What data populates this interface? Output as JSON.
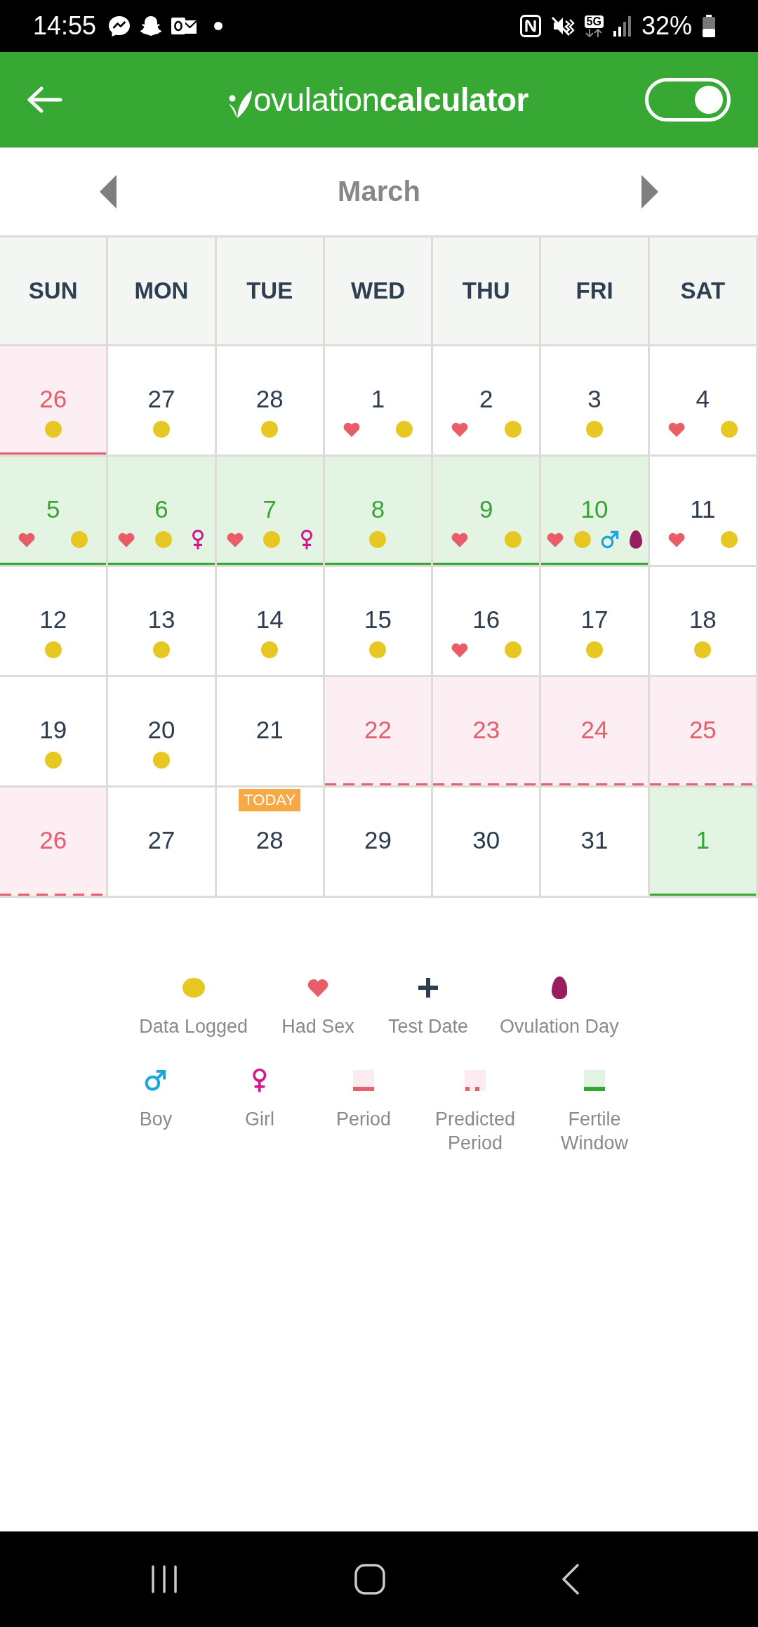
{
  "status_bar": {
    "time": "14:55",
    "network": "5G",
    "battery": "32%"
  },
  "header": {
    "logo": "ovulation**calculator**",
    "toggle": {
      "on": true
    }
  },
  "month_nav": {
    "month": "March"
  },
  "calendar": {
    "weekdays": [
      "SUN",
      "MON",
      "TUE",
      "WED",
      "THU",
      "FRI",
      "SAT"
    ],
    "weeks": [
      {
        "days": [
          {
            "day": "26",
            "kind": "period",
            "markers": [
              {
                "kind": "data_logged"
              }
            ]
          },
          {
            "day": "27",
            "kind": "normal",
            "markers": [
              {
                "kind": "data_logged"
              }
            ]
          },
          {
            "day": "28",
            "kind": "normal",
            "markers": [
              {
                "kind": "data_logged"
              }
            ]
          },
          {
            "day": "1",
            "kind": "normal",
            "markers": [
              {
                "kind": "had_sex"
              },
              {
                "kind": "data_logged"
              }
            ]
          },
          {
            "day": "2",
            "kind": "normal",
            "markers": [
              {
                "kind": "had_sex"
              },
              {
                "kind": "data_logged"
              }
            ]
          },
          {
            "day": "3",
            "kind": "normal",
            "markers": [
              {
                "kind": "data_logged"
              }
            ]
          },
          {
            "day": "4",
            "kind": "normal",
            "markers": [
              {
                "kind": "had_sex"
              },
              {
                "kind": "data_logged"
              }
            ]
          }
        ]
      },
      {
        "days": [
          {
            "day": "5",
            "kind": "fertile",
            "markers": [
              {
                "kind": "had_sex"
              },
              {
                "kind": "data_logged"
              }
            ]
          },
          {
            "day": "6",
            "kind": "fertile",
            "markers": [
              {
                "kind": "had_sex"
              },
              {
                "kind": "data_logged"
              },
              {
                "kind": "girl"
              }
            ]
          },
          {
            "day": "7",
            "kind": "fertile",
            "markers": [
              {
                "kind": "had_sex"
              },
              {
                "kind": "data_logged"
              },
              {
                "kind": "girl"
              }
            ]
          },
          {
            "day": "8",
            "kind": "fertile",
            "markers": [
              {
                "kind": "data_logged"
              }
            ]
          },
          {
            "day": "9",
            "kind": "fertile",
            "markers": [
              {
                "kind": "had_sex"
              },
              {
                "kind": "data_logged"
              }
            ]
          },
          {
            "day": "10",
            "kind": "fertile",
            "markers": [
              {
                "kind": "had_sex"
              },
              {
                "kind": "data_logged"
              },
              {
                "kind": "boy"
              },
              {
                "kind": "ovulation_day"
              }
            ]
          },
          {
            "day": "11",
            "kind": "normal",
            "markers": [
              {
                "kind": "had_sex"
              },
              {
                "kind": "data_logged"
              }
            ]
          }
        ]
      },
      {
        "days": [
          {
            "day": "12",
            "kind": "normal",
            "markers": [
              {
                "kind": "data_logged"
              }
            ]
          },
          {
            "day": "13",
            "kind": "normal",
            "markers": [
              {
                "kind": "data_logged"
              }
            ]
          },
          {
            "day": "14",
            "kind": "normal",
            "markers": [
              {
                "kind": "data_logged"
              }
            ]
          },
          {
            "day": "15",
            "kind": "normal",
            "markers": [
              {
                "kind": "data_logged"
              }
            ]
          },
          {
            "day": "16",
            "kind": "normal",
            "markers": [
              {
                "kind": "had_sex"
              },
              {
                "kind": "data_logged"
              }
            ]
          },
          {
            "day": "17",
            "kind": "normal",
            "markers": [
              {
                "kind": "data_logged"
              }
            ]
          },
          {
            "day": "18",
            "kind": "normal",
            "markers": [
              {
                "kind": "data_logged"
              }
            ]
          }
        ]
      },
      {
        "days": [
          {
            "day": "19",
            "kind": "normal",
            "markers": [
              {
                "kind": "data_logged"
              }
            ]
          },
          {
            "day": "20",
            "kind": "normal",
            "markers": [
              {
                "kind": "data_logged"
              }
            ]
          },
          {
            "day": "21",
            "kind": "normal"
          },
          {
            "day": "22",
            "kind": "predicted_period"
          },
          {
            "day": "23",
            "kind": "predicted_period"
          },
          {
            "day": "24",
            "kind": "predicted_period"
          },
          {
            "day": "25",
            "kind": "predicted_period"
          }
        ]
      },
      {
        "days": [
          {
            "day": "26",
            "kind": "predicted_period"
          },
          {
            "day": "27",
            "kind": "normal"
          },
          {
            "day": "28",
            "kind": "normal",
            "badge": "TODAY"
          },
          {
            "day": "29",
            "kind": "normal"
          },
          {
            "day": "30",
            "kind": "normal"
          },
          {
            "day": "31",
            "kind": "normal"
          },
          {
            "day": "1",
            "kind": "fertile"
          }
        ]
      }
    ]
  },
  "legend": {
    "rows": [
      {
        "items": [
          {
            "kind": "data_logged",
            "label": "Data Logged"
          },
          {
            "kind": "had_sex",
            "label": "Had Sex"
          },
          {
            "kind": "test_date",
            "label": "Test Date"
          },
          {
            "kind": "ovulation_day",
            "label": "Ovulation Day"
          }
        ]
      },
      {
        "items": [
          {
            "kind": "boy",
            "label": "Boy"
          },
          {
            "kind": "girl",
            "label": "Girl"
          },
          {
            "kind": "period",
            "label": "Period"
          },
          {
            "kind": "predicted_period",
            "label": "Predicted Period"
          },
          {
            "kind": "fertile_window",
            "label": "Fertile Window"
          }
        ]
      }
    ]
  }
}
